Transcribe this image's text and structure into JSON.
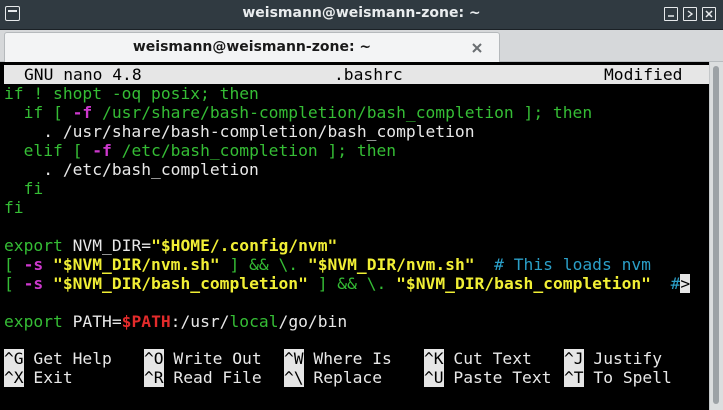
{
  "window": {
    "title": "weismann@weismann-zone: ~",
    "menu_icon": "window-menu-icon",
    "controls": [
      "minimize-icon",
      "maximize-icon",
      "close-icon"
    ]
  },
  "tabs": [
    {
      "label": "weismann@weismann-zone: ~",
      "close_icon": "close-x-icon"
    }
  ],
  "nano": {
    "version": "GNU nano 4.8",
    "filename": ".bashrc",
    "status": "Modified"
  },
  "file_lines": [
    [
      [
        "if ! shopt -oq posix; then",
        "g"
      ]
    ],
    [
      [
        "  if [ ",
        "g"
      ],
      [
        "-f",
        "m"
      ],
      [
        " /usr/share/bash-completion/bash_completion ]; then",
        "g"
      ]
    ],
    [
      [
        "    . /usr/share/bash-completion/bash_completion",
        "w"
      ]
    ],
    [
      [
        "  elif [ ",
        "g"
      ],
      [
        "-f",
        "m"
      ],
      [
        " /etc/bash_completion ]; then",
        "g"
      ]
    ],
    [
      [
        "    . /etc/bash_completion",
        "w"
      ]
    ],
    [
      [
        "  fi",
        "g"
      ]
    ],
    [
      [
        "fi",
        "g"
      ]
    ],
    [
      [
        "",
        "w"
      ]
    ],
    [
      [
        "export",
        "g"
      ],
      [
        " NVM_DIR=",
        "w"
      ],
      [
        "\"$HOME/.config/nvm\"",
        "y"
      ]
    ],
    [
      [
        "[ ",
        "g"
      ],
      [
        "-s",
        "m"
      ],
      [
        " ",
        "w"
      ],
      [
        "\"$NVM_DIR/nvm.sh\"",
        "y"
      ],
      [
        " ] && \\. ",
        "g"
      ],
      [
        "\"$NVM_DIR/nvm.sh\"",
        "y"
      ],
      [
        "  # This loads nvm",
        "c"
      ]
    ],
    [
      [
        "[ ",
        "g"
      ],
      [
        "-s",
        "m"
      ],
      [
        " ",
        "w"
      ],
      [
        "\"$NVM_DIR/bash_completion\"",
        "y"
      ],
      [
        " ] && \\. ",
        "g"
      ],
      [
        "\"$NVM_DIR/bash_completion\"",
        "y"
      ],
      [
        "  #",
        "c"
      ],
      [
        ">",
        "inv"
      ]
    ],
    [
      [
        "",
        "w"
      ]
    ],
    [
      [
        "export",
        "g"
      ],
      [
        " PATH=",
        "w"
      ],
      [
        "$PATH",
        "r"
      ],
      [
        ":/usr/",
        "w"
      ],
      [
        "local",
        "g"
      ],
      [
        "/go/bin",
        "w"
      ]
    ]
  ],
  "shortcuts": [
    [
      {
        "key": "^G",
        "label": "Get Help"
      },
      {
        "key": "^O",
        "label": "Write Out"
      },
      {
        "key": "^W",
        "label": "Where Is"
      },
      {
        "key": "^K",
        "label": "Cut Text"
      },
      {
        "key": "^J",
        "label": "Justify"
      }
    ],
    [
      {
        "key": "^X",
        "label": "Exit"
      },
      {
        "key": "^R",
        "label": "Read File"
      },
      {
        "key": "^\\",
        "label": "Replace"
      },
      {
        "key": "^U",
        "label": "Paste Text"
      },
      {
        "key": "^T",
        "label": "To Spell"
      }
    ]
  ],
  "colors": {
    "green": "#35bd35",
    "magenta": "#cd38cd",
    "yellow": "#f1ef35",
    "red": "#e32b2b",
    "cyan": "#2b9fc8",
    "text": "#e8e8e8",
    "header_bg": "#e6e6e6"
  }
}
